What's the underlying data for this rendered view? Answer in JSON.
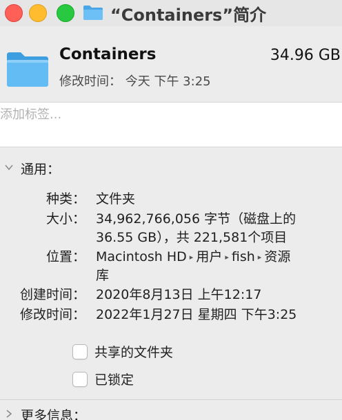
{
  "window": {
    "title": "“Containers”简介",
    "icon": "folder-icon",
    "controls": [
      "close",
      "minimize",
      "zoom"
    ],
    "colors": {
      "close": "#fe5f57",
      "minimize": "#febc2e",
      "zoom": "#28c840",
      "folder": "#5ab4f0"
    }
  },
  "header": {
    "name": "Containers",
    "size": "34.96 GB",
    "modified_label": "修改时间：",
    "modified_value": "今天 下午 3:25"
  },
  "tags": {
    "placeholder": "添加标签...",
    "value": ""
  },
  "general": {
    "section_label": "通用：",
    "expanded": true,
    "rows": [
      {
        "label": "种类：",
        "lines": [
          "文件夹"
        ]
      },
      {
        "label": "大小：",
        "lines": [
          "34,962,766,056 字节（磁盘上的",
          "36.55 GB），共 221,581个项目"
        ]
      },
      {
        "label": "位置：",
        "path": [
          "Macintosh HD",
          "用户",
          "fish",
          "资源"
        ],
        "path_wrap": "库"
      },
      {
        "label": "创建时间：",
        "lines": [
          "2020年8月13日 上午12:17"
        ]
      },
      {
        "label": "修改时间：",
        "lines": [
          "2022年1月27日 星期四 下午3:25"
        ]
      }
    ],
    "checkboxes": [
      {
        "label": "共享的文件夹",
        "checked": false
      },
      {
        "label": "已锁定",
        "checked": false
      }
    ]
  },
  "more_info": {
    "section_label": "更多信息：",
    "expanded": false
  },
  "path_separator": "▸"
}
